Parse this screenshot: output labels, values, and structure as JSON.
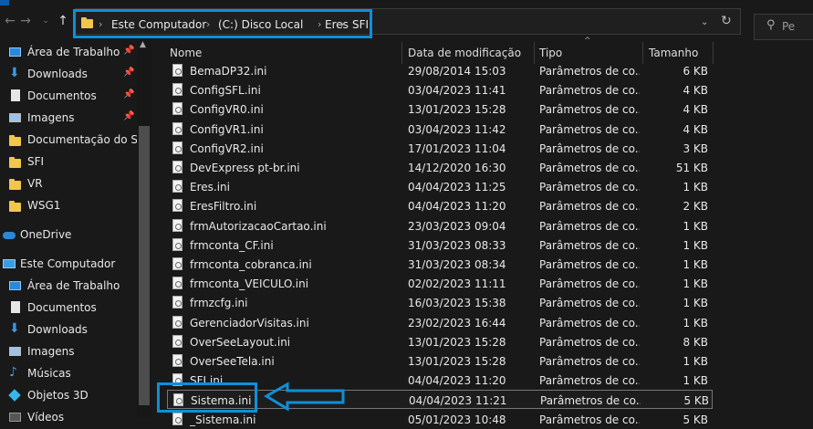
{
  "address": {
    "crumbs": [
      "Este Computador",
      "(C:) Disco Local",
      "Eres",
      "SFI"
    ]
  },
  "search": {
    "placeholder": "Pe"
  },
  "sidebar": {
    "items": [
      {
        "label": "Área de Trabalho",
        "icon": "desktop-icon",
        "pinned": true
      },
      {
        "label": "Downloads",
        "icon": "download-icon",
        "pinned": true
      },
      {
        "label": "Documentos",
        "icon": "document-icon",
        "pinned": true
      },
      {
        "label": "Imagens",
        "icon": "pictures-icon",
        "pinned": true
      },
      {
        "label": "Documentação do Sist",
        "icon": "folder-icon"
      },
      {
        "label": "SFI",
        "icon": "folder-icon"
      },
      {
        "label": "VR",
        "icon": "folder-icon"
      },
      {
        "label": "WSG1",
        "icon": "folder-icon"
      },
      {
        "label": "OneDrive",
        "icon": "onedrive-icon"
      },
      {
        "label": "Este Computador",
        "icon": "computer-icon"
      },
      {
        "label": "Área de Trabalho",
        "icon": "desktop-icon"
      },
      {
        "label": "Documentos",
        "icon": "document-icon"
      },
      {
        "label": "Downloads",
        "icon": "download-icon"
      },
      {
        "label": "Imagens",
        "icon": "pictures-icon"
      },
      {
        "label": "Músicas",
        "icon": "music-icon"
      },
      {
        "label": "Objetos 3D",
        "icon": "objects-3d-icon"
      },
      {
        "label": "Vídeos",
        "icon": "videos-icon"
      }
    ]
  },
  "columns": {
    "name": "Nome",
    "date": "Data de modificação",
    "type": "Tipo",
    "size": "Tamanho"
  },
  "files": [
    {
      "name": "BemaDP32.ini",
      "date": "29/08/2014 15:03",
      "type": "Parâmetros de co...",
      "size": "6 KB"
    },
    {
      "name": "ConfigSFL.ini",
      "date": "03/04/2023 11:41",
      "type": "Parâmetros de co...",
      "size": "4 KB"
    },
    {
      "name": "ConfigVR0.ini",
      "date": "13/01/2023 15:28",
      "type": "Parâmetros de co...",
      "size": "4 KB"
    },
    {
      "name": "ConfigVR1.ini",
      "date": "03/04/2023 11:42",
      "type": "Parâmetros de co...",
      "size": "4 KB"
    },
    {
      "name": "ConfigVR2.ini",
      "date": "17/01/2023 11:04",
      "type": "Parâmetros de co...",
      "size": "3 KB"
    },
    {
      "name": "DevExpress pt-br.ini",
      "date": "14/12/2020 16:30",
      "type": "Parâmetros de co...",
      "size": "51 KB"
    },
    {
      "name": "Eres.ini",
      "date": "04/04/2023 11:25",
      "type": "Parâmetros de co...",
      "size": "1 KB"
    },
    {
      "name": "EresFiltro.ini",
      "date": "04/04/2023 11:20",
      "type": "Parâmetros de co...",
      "size": "2 KB"
    },
    {
      "name": "frmAutorizacaoCartao.ini",
      "date": "23/03/2023 09:04",
      "type": "Parâmetros de co...",
      "size": "1 KB"
    },
    {
      "name": "frmconta_CF.ini",
      "date": "31/03/2023 08:33",
      "type": "Parâmetros de co...",
      "size": "1 KB"
    },
    {
      "name": "frmconta_cobranca.ini",
      "date": "31/03/2023 08:34",
      "type": "Parâmetros de co...",
      "size": "1 KB"
    },
    {
      "name": "frmconta_VEICULO.ini",
      "date": "02/02/2023 11:11",
      "type": "Parâmetros de co...",
      "size": "1 KB"
    },
    {
      "name": "frmzcfg.ini",
      "date": "16/03/2023 15:38",
      "type": "Parâmetros de co...",
      "size": "1 KB"
    },
    {
      "name": "GerenciadorVisitas.ini",
      "date": "23/02/2023 16:44",
      "type": "Parâmetros de co...",
      "size": "1 KB"
    },
    {
      "name": "OverSeeLayout.ini",
      "date": "13/01/2023 15:28",
      "type": "Parâmetros de co...",
      "size": "8 KB"
    },
    {
      "name": "OverSeeTela.ini",
      "date": "13/01/2023 15:28",
      "type": "Parâmetros de co...",
      "size": "1 KB"
    },
    {
      "name": "SFI.ini",
      "date": "04/04/2023 11:20",
      "type": "Parâmetros de co...",
      "size": "1 KB"
    },
    {
      "name": "Sistema.ini",
      "date": "04/04/2023 11:21",
      "type": "Parâmetros de co...",
      "size": "5 KB",
      "selected": true
    },
    {
      "name": "_Sistema.ini",
      "date": "05/01/2023 10:48",
      "type": "Parâmetros de co...",
      "size": "5 KB"
    }
  ],
  "colors": {
    "highlight": "#0e8fd8",
    "background": "#191919",
    "folder": "#f0c64b"
  }
}
